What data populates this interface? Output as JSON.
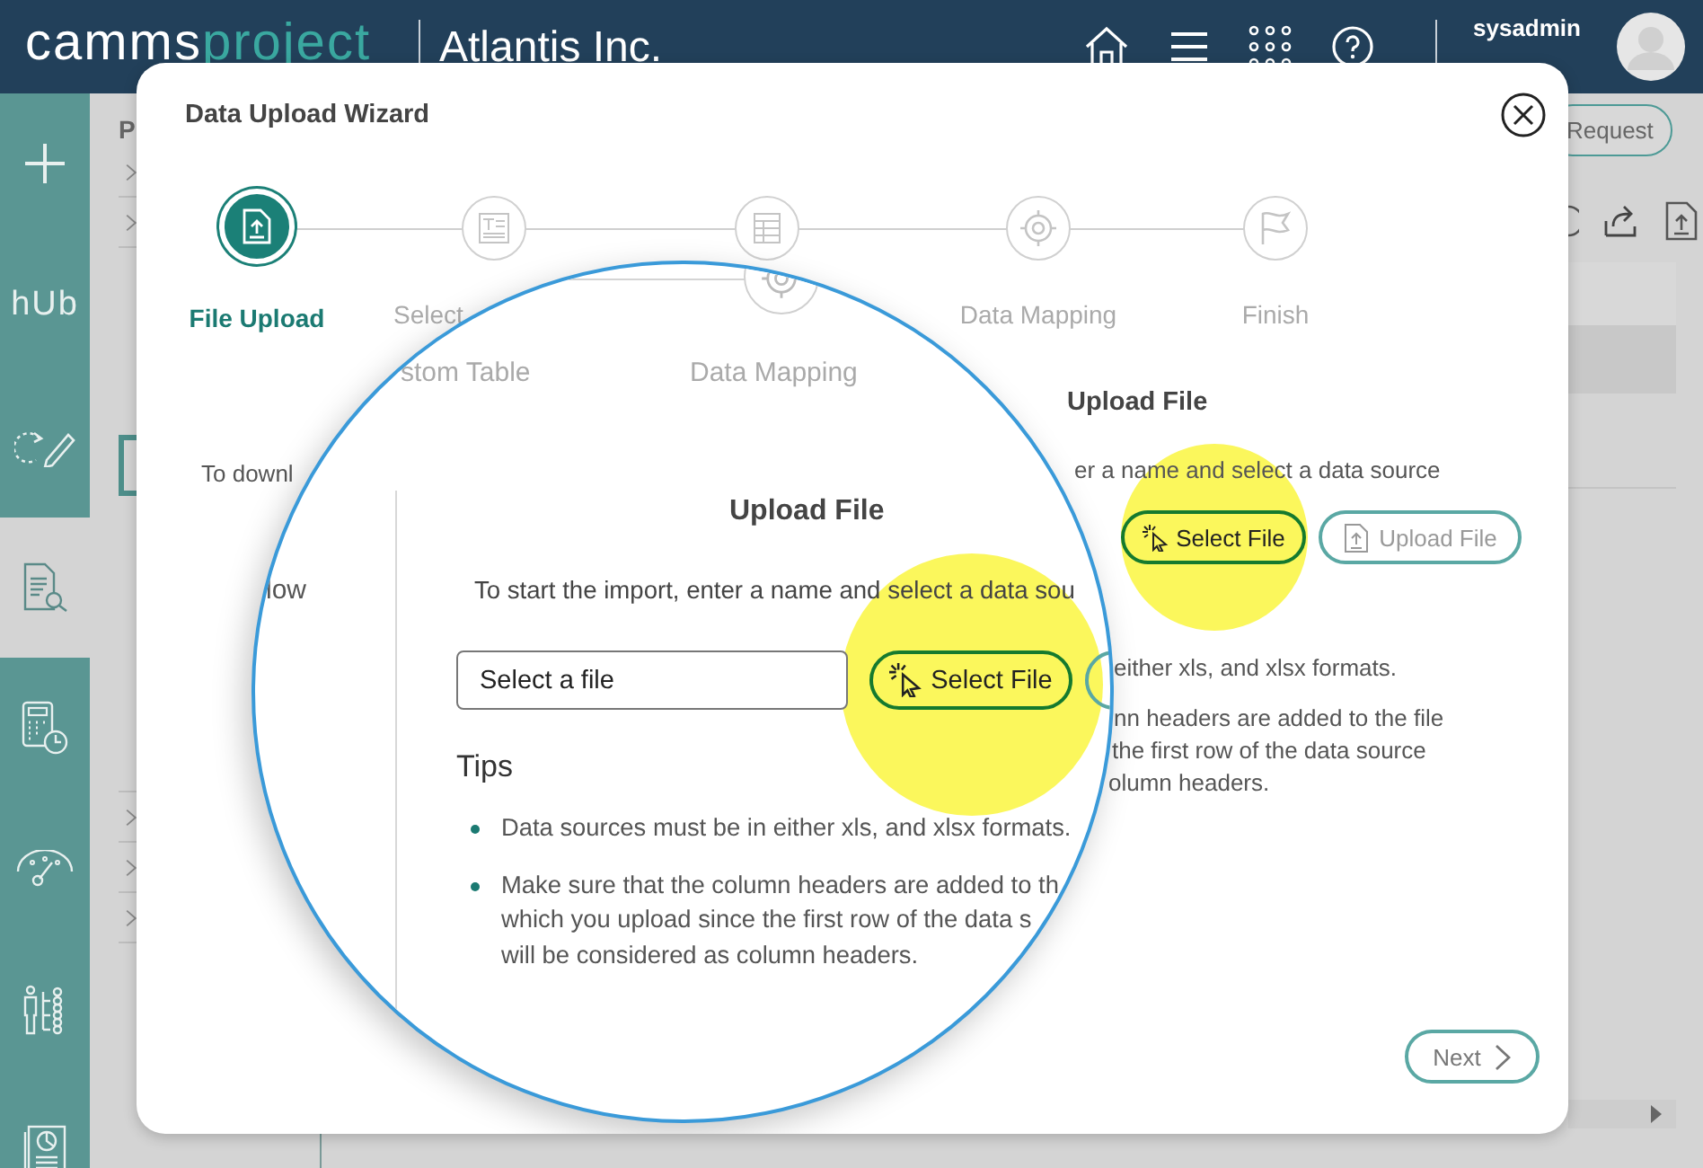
{
  "header": {
    "logo": {
      "part_1": "camms",
      "part_2": "project"
    },
    "company": "Atlantis Inc.",
    "user": "sysadmin"
  },
  "sidebar": {
    "items": [
      {
        "kind": "plus",
        "selected": false
      },
      {
        "kind": "hub",
        "label": "hUb",
        "selected": false
      },
      {
        "kind": "refresh-edit",
        "selected": false
      },
      {
        "kind": "doc-search",
        "selected": true
      },
      {
        "kind": "calculator",
        "selected": false
      },
      {
        "kind": "gauge",
        "selected": false
      },
      {
        "kind": "org",
        "selected": false
      },
      {
        "kind": "report",
        "selected": false
      }
    ]
  },
  "background": {
    "breadcrumb": "P",
    "request_button": "Request"
  },
  "dialog": {
    "title": "Data Upload Wizard",
    "steps": [
      {
        "kind": "upload",
        "label": "File Upload",
        "selected": true
      },
      {
        "kind": "text",
        "label": "Select",
        "selected": false
      },
      {
        "kind": "grid",
        "selected": false
      },
      {
        "kind": "target",
        "label": "Data Mapping",
        "selected": false
      },
      {
        "kind": "flag",
        "label": "Finish",
        "selected": false
      }
    ],
    "left_text": "To downl",
    "heading": "Upload File",
    "instruction": "er a name and select a data source",
    "select_button": "Select File",
    "upload_button": "Upload File",
    "tip_1": "either xls, and xlsx formats.",
    "tip_2_lines": [
      "nn headers are added to the file",
      "the first row of the data source",
      "olumn headers."
    ],
    "next_button": "Next"
  },
  "magnifier": {
    "step_labels": [
      "stom Table",
      "Data Mapping"
    ],
    "left_text": "low",
    "heading": "Upload File",
    "instruction": "To start the import, enter a name and select a data sou",
    "file_field": {
      "placeholder": "Select a file"
    },
    "select_button": "Select File",
    "tips_title": "Tips",
    "tips": [
      {
        "lines": [
          "Data sources must be in either xls, and xlsx formats."
        ]
      },
      {
        "lines": [
          "Make sure that the column headers are added to th",
          "which you upload since the first row of the data s",
          "will be considered as column headers."
        ]
      }
    ]
  }
}
